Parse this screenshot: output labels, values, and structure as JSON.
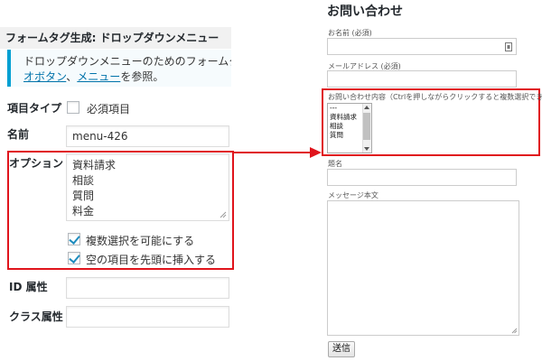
{
  "left": {
    "title": "フォームタグ生成: ドロップダウンメニュー",
    "info_line1": "ドロップダウンメニューのためのフォームタ",
    "info_link1": "オボタン",
    "info_sep": "、",
    "info_link2": "メニュー",
    "info_tail": "を参照。",
    "item_type_label": "項目タイプ",
    "required_label": "必須項目",
    "name_label": "名前",
    "name_value": "menu-426",
    "options_label": "オプション",
    "options_text": "資料請求\n相談\n質問\n料金",
    "multi_select_label": "複数選択を可能にする",
    "multi_select_checked": true,
    "blank_first_label": "空の項目を先頭に挿入する",
    "blank_first_checked": true,
    "id_attr_label": "ID 属性",
    "class_attr_label": "クラス属性"
  },
  "right": {
    "form_title": "お問い合わせ",
    "name_field_label": "お名前 (必須)",
    "email_field_label": "メールアドレス (必須)",
    "inquiry_label": "お問い合わせ内容（Ctrlを押しながらクリックすると複数選択できます）",
    "inquiry_options": [
      "---",
      "資料請求",
      "相談",
      "質問"
    ],
    "subject_label": "題名",
    "message_label": "メッセージ本文",
    "submit_label": "送信"
  },
  "colors": {
    "highlight": "#e0141c",
    "wp_blue": "#1e8cbe",
    "info_border": "#00a0d2"
  }
}
